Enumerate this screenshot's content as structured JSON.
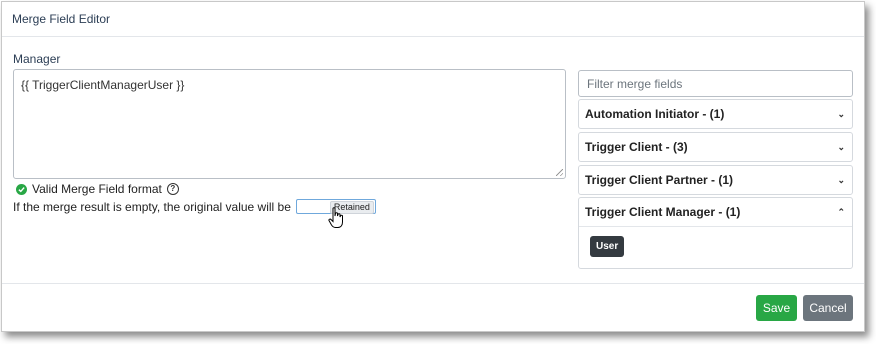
{
  "dialog": {
    "title": "Merge Field Editor"
  },
  "field": {
    "label": "Manager",
    "editor_value": "{{ TriggerClientManagerUser }}",
    "valid_text": "Valid Merge Field format",
    "help_glyph": "?",
    "empty_text": "If the merge result is empty, the original value will be",
    "empty_option": "Retained"
  },
  "filter": {
    "placeholder": "Filter merge fields"
  },
  "groups": [
    {
      "label": "Automation Initiator - (1)",
      "expanded": false
    },
    {
      "label": "Trigger Client - (3)",
      "expanded": false
    },
    {
      "label": "Trigger Client Partner - (1)",
      "expanded": false
    },
    {
      "label": "Trigger Client Manager - (1)",
      "expanded": true,
      "items": [
        "User"
      ]
    }
  ],
  "footer": {
    "save_label": "Save",
    "cancel_label": "Cancel"
  },
  "colors": {
    "save": "#28a745",
    "cancel": "#6c757d",
    "chip": "#343a40",
    "valid": "#28a745"
  }
}
